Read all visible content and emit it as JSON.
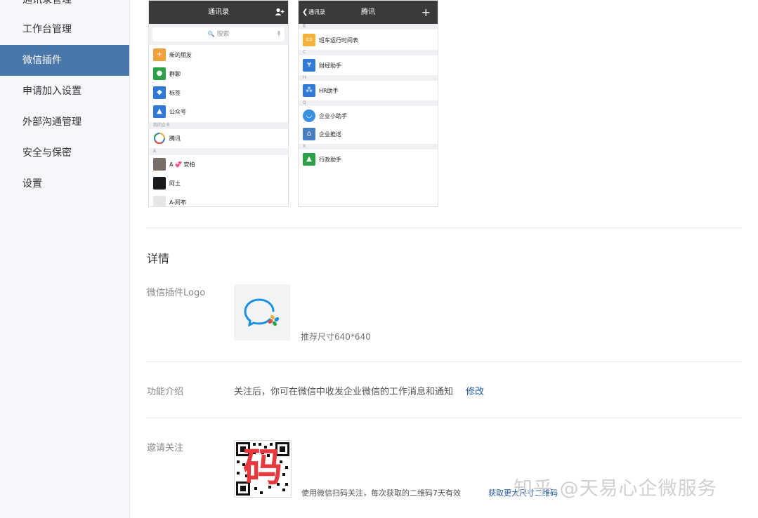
{
  "sidebar": {
    "items": [
      {
        "label": "通讯录管理"
      },
      {
        "label": "工作台管理"
      },
      {
        "label": "微信插件"
      },
      {
        "label": "申请加入设置"
      },
      {
        "label": "外部沟通管理"
      },
      {
        "label": "安全与保密"
      },
      {
        "label": "设置"
      }
    ]
  },
  "phone1": {
    "title": "通讯录",
    "search_placeholder": "搜索",
    "rows": [
      {
        "label": "新的朋友",
        "color": "#f0a03c"
      },
      {
        "label": "群聊",
        "color": "#2ba245"
      },
      {
        "label": "标签",
        "color": "#2f7ad6"
      },
      {
        "label": "公众号",
        "color": "#2f7ad6"
      }
    ],
    "section_company": "我的企业",
    "company": "腾讯",
    "section_a": "A",
    "contacts": [
      {
        "label": "A 💞 安柏"
      },
      {
        "label": "阿土"
      },
      {
        "label": "A-阿布"
      }
    ]
  },
  "phone2": {
    "back": "通讯录",
    "title": "腾讯",
    "add": "+",
    "sections": [
      "B",
      "C",
      "H",
      "Q",
      "X"
    ],
    "rows": [
      {
        "label": "班车运行时间表",
        "color": "#f3b33d"
      },
      {
        "label": "财经助手",
        "color": "#2f7ad6"
      },
      {
        "label": "HR助手",
        "color": "#2f7ad6"
      },
      {
        "label": "企业小助手",
        "color": "#3a8fe0"
      },
      {
        "label": "企业推送",
        "color": "#4a7fbf"
      },
      {
        "label": "行政助手",
        "color": "#2ba245"
      }
    ]
  },
  "details": {
    "heading": "详情",
    "logo_label": "微信插件Logo",
    "logo_hint": "推荐尺寸640*640",
    "intro_label": "功能介绍",
    "intro_text": "关注后，你可在微信中收发企业微信的工作消息和通知",
    "intro_edit": "修改",
    "invite_label": "邀请关注",
    "invite_text": "使用微信扫码关注，每次获取的二维码7天有效",
    "invite_link": "获取更大尺寸二维码",
    "qr_overlay": "码"
  },
  "watermark": "知乎 @天易心企微服务"
}
